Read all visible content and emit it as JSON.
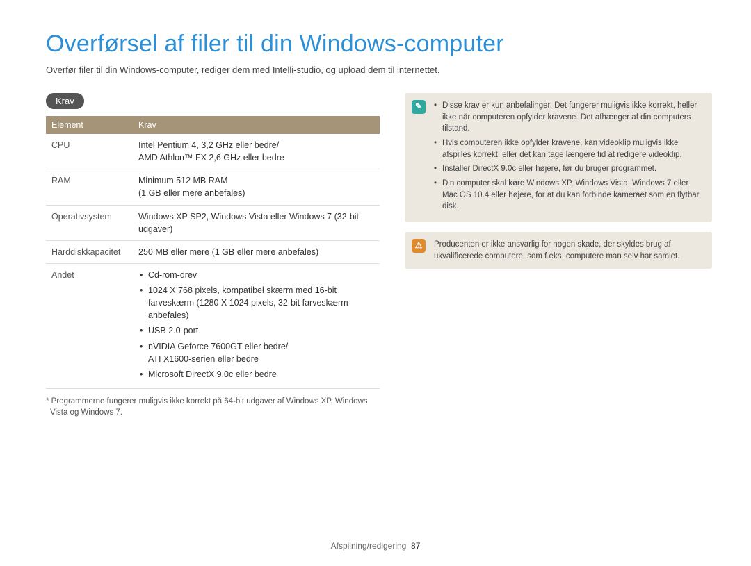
{
  "title": "Overførsel af filer til din Windows-computer",
  "intro": "Overfør filer til din Windows-computer, rediger dem med Intelli-studio, og upload dem til internettet.",
  "pill": "Krav",
  "table": {
    "head_element": "Element",
    "head_krav": "Krav",
    "rows": [
      {
        "label": "CPU",
        "value": "Intel Pentium 4, 3,2 GHz eller bedre/\nAMD Athlon™ FX 2,6 GHz eller bedre"
      },
      {
        "label": "RAM",
        "value": "Minimum 512 MB RAM\n(1 GB eller mere anbefales)"
      },
      {
        "label": "Operativsystem",
        "value": "Windows XP SP2, Windows Vista eller Windows 7 (32-bit udgaver)"
      },
      {
        "label": "Harddiskkapacitet",
        "value": "250 MB eller mere (1 GB eller mere anbefales)"
      }
    ],
    "andet_label": "Andet",
    "andet_items": [
      "Cd-rom-drev",
      "1024 X 768 pixels, kompatibel skærm med 16-bit farveskærm (1280 X 1024 pixels, 32-bit farveskærm anbefales)",
      "USB 2.0-port",
      "nVIDIA Geforce 7600GT eller bedre/\nATI X1600-serien eller bedre",
      "Microsoft DirectX 9.0c eller bedre"
    ]
  },
  "footnote": "* Programmerne fungerer muligvis ikke korrekt på 64-bit udgaver af Windows XP, Windows Vista og Windows 7.",
  "info_items": [
    "Disse krav er kun anbefalinger. Det fungerer muligvis ikke korrekt, heller ikke når computeren opfylder kravene. Det afhænger af din computers tilstand.",
    "Hvis computeren ikke opfylder kravene, kan videoklip muligvis ikke afspilles korrekt, eller det kan tage længere tid at redigere videoklip.",
    "Installer DirectX 9.0c eller højere, før du bruger programmet.",
    "Din computer skal køre Windows XP, Windows Vista, Windows 7 eller Mac OS 10.4 eller højere, for at du kan forbinde kameraet som en flytbar disk."
  ],
  "warn_text": "Producenten er ikke ansvarlig for nogen skade, der skyldes brug af ukvalificerede computere, som f.eks. computere man selv har samlet.",
  "footer_section": "Afspilning/redigering",
  "footer_page": "87",
  "icons": {
    "info_glyph": "✎",
    "warn_glyph": "⚠"
  }
}
